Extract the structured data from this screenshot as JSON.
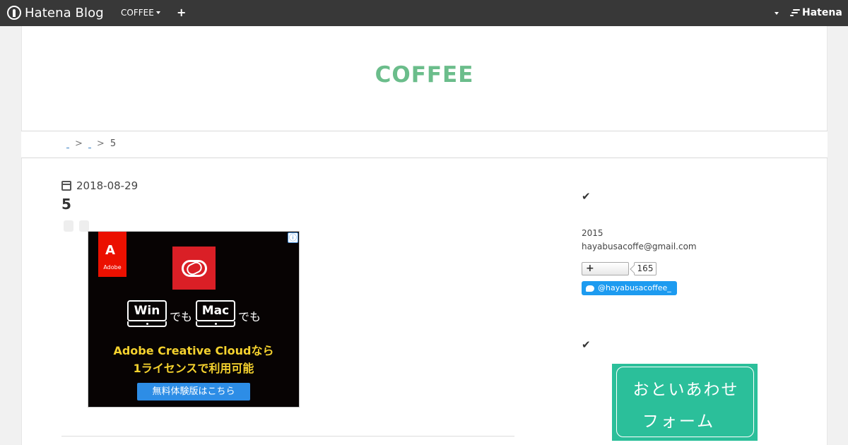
{
  "topbar": {
    "logo_text": "Hatena Blog",
    "blog_menu_label": "COFFEE",
    "add_label": "+",
    "brand_label": "Hatena"
  },
  "blog": {
    "title": "COFFEE"
  },
  "breadcrumb": {
    "separator": ">",
    "current": "5"
  },
  "entry": {
    "date": "2018-08-29",
    "title": "5"
  },
  "ad": {
    "info_icon": "ⓘ",
    "brand": "Adobe",
    "brand_mark": "A",
    "win_label": "Win",
    "mac_label": "Mac",
    "demo_text": "でも",
    "line1": "Adobe Creative Cloudなら",
    "line2": "1ライセンスで利用可能",
    "cta": "無料体験版はこちら"
  },
  "sidebar": {
    "profile_year": "2015",
    "profile_email": "hayabusacoffe@gmail.com",
    "follow_plus": "+",
    "follow_count": "165",
    "twitter_handle": "@hayabusacoffee_",
    "check_glyph": "✔",
    "contact_line1": "おといあわせ",
    "contact_line2": "フォーム"
  }
}
